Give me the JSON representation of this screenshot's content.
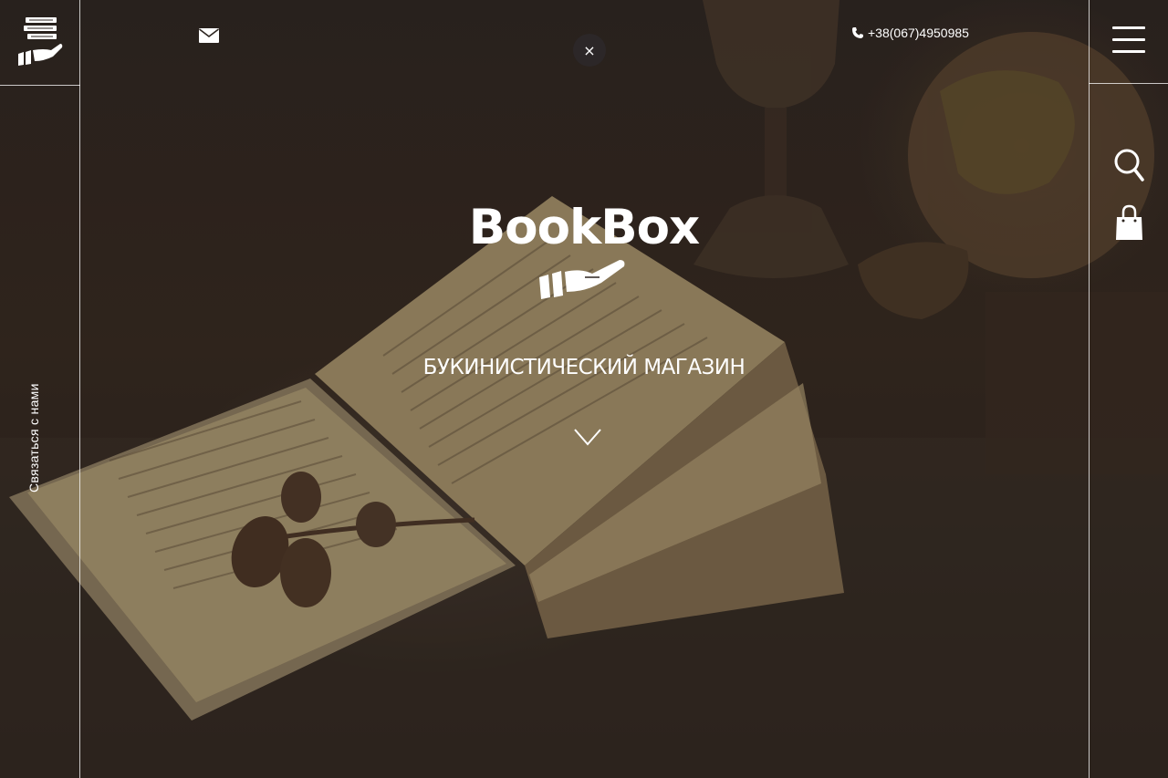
{
  "colors": {
    "background": "#2d2520",
    "text": "#ffffff",
    "close_button_bg": "#2d282a"
  },
  "header": {
    "logo_icon": "books-on-hand-icon",
    "mail_icon": "envelope-icon",
    "close_label": "×",
    "phone_icon": "phone-icon",
    "phone_number": "+38(067)4950985",
    "menu_icon": "hamburger-menu-icon"
  },
  "sidebar_right": {
    "search_icon": "search-icon",
    "cart_icon": "shopping-bag-icon"
  },
  "sidebar_left": {
    "contact_label": "Связаться с нами"
  },
  "hero": {
    "brand": "BookBox",
    "brand_icon": "hand-with-books-icon",
    "tagline": "БУКИНИСТИЧЕСКИЙ МАГАЗИН",
    "scroll_icon": "chevron-down-icon"
  }
}
